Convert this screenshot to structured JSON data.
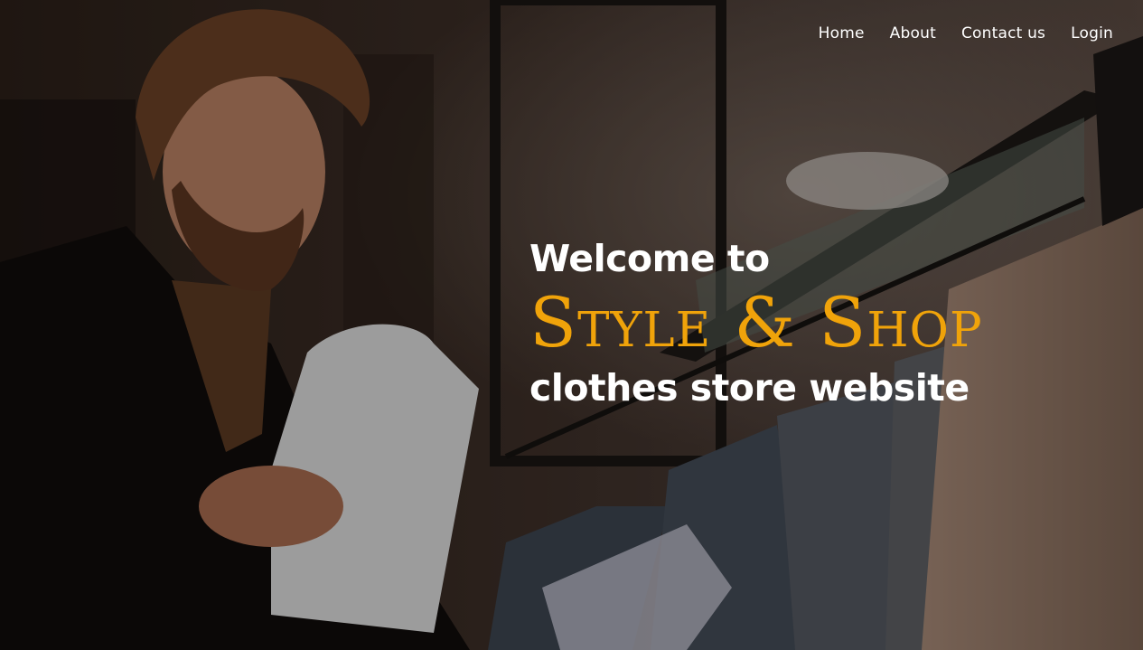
{
  "nav": {
    "items": [
      {
        "label": "Home"
      },
      {
        "label": "About"
      },
      {
        "label": "Contact us"
      },
      {
        "label": "Login"
      }
    ]
  },
  "hero": {
    "welcome": "Welcome to",
    "brand": "Style & Shop",
    "tagline": "clothes store website",
    "background_image": "man holding folded shirts in clothing store",
    "brand_color": "#f0a30a",
    "text_color": "#ffffff"
  }
}
